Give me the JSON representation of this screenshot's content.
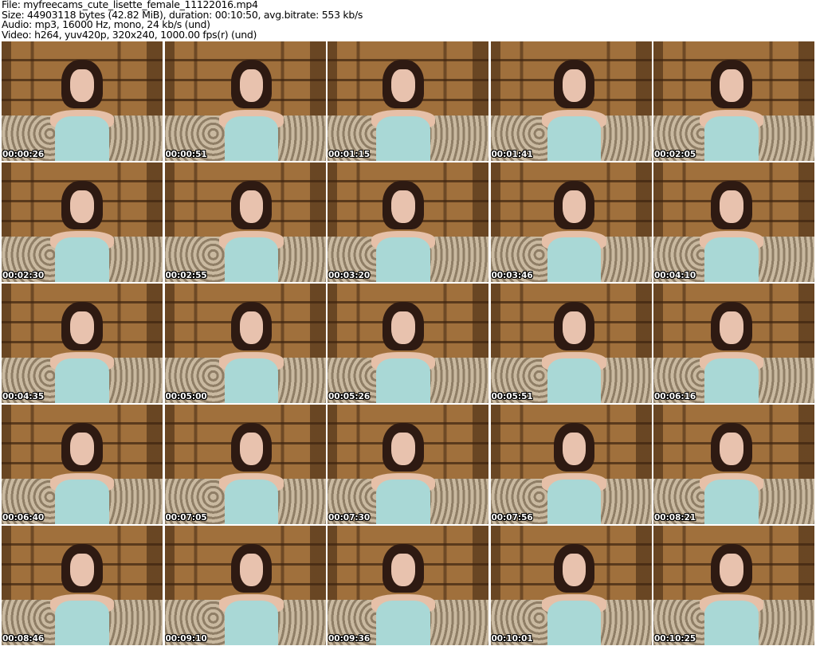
{
  "header": {
    "file": "File: myfreecams_cute_lisette_female_11122016.mp4",
    "size": "Size: 44903118 bytes (42.82 MiB), duration: 00:10:50, avg.bitrate: 553 kb/s",
    "audio": "Audio: mp3, 16000 Hz, mono, 24 kb/s (und)",
    "video": "Video: h264, yuv420p, 320x240, 1000.00 fps(r) (und)"
  },
  "thumbnails": [
    {
      "timestamp": "00:00:26"
    },
    {
      "timestamp": "00:00:51"
    },
    {
      "timestamp": "00:01:15"
    },
    {
      "timestamp": "00:01:41"
    },
    {
      "timestamp": "00:02:05"
    },
    {
      "timestamp": "00:02:30"
    },
    {
      "timestamp": "00:02:55"
    },
    {
      "timestamp": "00:03:20"
    },
    {
      "timestamp": "00:03:46"
    },
    {
      "timestamp": "00:04:10"
    },
    {
      "timestamp": "00:04:35"
    },
    {
      "timestamp": "00:05:00"
    },
    {
      "timestamp": "00:05:26"
    },
    {
      "timestamp": "00:05:51"
    },
    {
      "timestamp": "00:06:16"
    },
    {
      "timestamp": "00:06:40"
    },
    {
      "timestamp": "00:07:05"
    },
    {
      "timestamp": "00:07:30"
    },
    {
      "timestamp": "00:07:56"
    },
    {
      "timestamp": "00:08:21"
    },
    {
      "timestamp": "00:08:46"
    },
    {
      "timestamp": "00:09:10"
    },
    {
      "timestamp": "00:09:36"
    },
    {
      "timestamp": "00:10:01"
    },
    {
      "timestamp": "00:10:25"
    }
  ]
}
